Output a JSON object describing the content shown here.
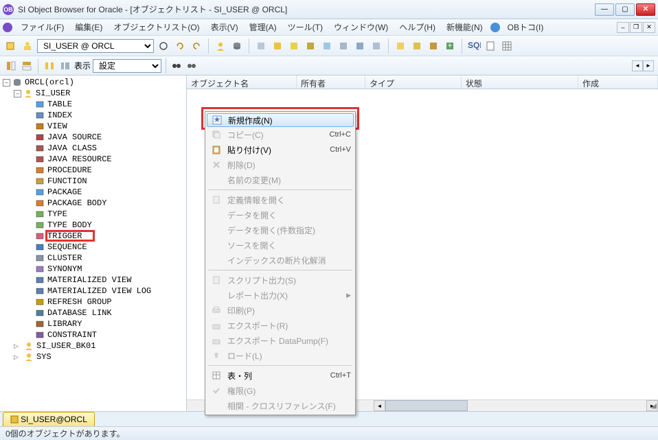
{
  "title": "SI Object Browser for Oracle - [オブジェクトリスト - SI_USER @ ORCL]",
  "menus": {
    "file": "ファイル(F)",
    "edit": "編集(E)",
    "objlist": "オブジェクトリスト(O)",
    "view": "表示(V)",
    "manage": "管理(A)",
    "tool": "ツール(T)",
    "window": "ウィンドウ(W)",
    "help": "ヘルプ(H)",
    "new_feature": "新機能(N)",
    "obtoko": "OBトコ(I)"
  },
  "toolbar": {
    "user_combo": "SI_USER @ ORCL"
  },
  "subbar": {
    "display_label": "表示",
    "display_combo": "設定"
  },
  "tree": {
    "root": "ORCL(orcl)",
    "schemas": [
      {
        "name": "SI_USER",
        "expanded": true
      },
      {
        "name": "SI_USER_BK01",
        "expanded": false
      },
      {
        "name": "SYS",
        "expanded": false
      }
    ],
    "obj_types": [
      "TABLE",
      "INDEX",
      "VIEW",
      "JAVA SOURCE",
      "JAVA CLASS",
      "JAVA RESOURCE",
      "PROCEDURE",
      "FUNCTION",
      "PACKAGE",
      "PACKAGE BODY",
      "TYPE",
      "TYPE BODY",
      "TRIGGER",
      "SEQUENCE",
      "CLUSTER",
      "SYNONYM",
      "MATERIALIZED VIEW",
      "MATERIALIZED VIEW LOG",
      "REFRESH GROUP",
      "DATABASE LINK",
      "LIBRARY",
      "CONSTRAINT"
    ],
    "icon_colors": {
      "TABLE": "#5aa0e0",
      "INDEX": "#6a8fbf",
      "VIEW": "#c08020",
      "JAVA SOURCE": "#b04848",
      "JAVA CLASS": "#a85858",
      "JAVA RESOURCE": "#a85858",
      "PROCEDURE": "#d88030",
      "FUNCTION": "#c8a040",
      "PACKAGE": "#5aa0e0",
      "PACKAGE BODY": "#d88030",
      "TYPE": "#7ab060",
      "TYPE BODY": "#7ab060",
      "TRIGGER": "#d86080",
      "SEQUENCE": "#4a80c0",
      "CLUSTER": "#8896a8",
      "SYNONYM": "#9a80c0",
      "MATERIALIZED VIEW": "#6080b0",
      "MATERIALIZED VIEW LOG": "#6080b0",
      "REFRESH GROUP": "#c8a000",
      "DATABASE LINK": "#5080a0",
      "LIBRARY": "#a06836",
      "CONSTRAINT": "#8060a0"
    }
  },
  "list_columns": {
    "objname": "オブジェクト名",
    "owner": "所有者",
    "type": "タイプ",
    "status": "状態",
    "created": "作成"
  },
  "context_menu": {
    "new": "新規作成(N)",
    "copy": "コピー(C)",
    "paste": "貼り付け(V)",
    "delete": "削除(D)",
    "rename": "名前の変更(M)",
    "open_def": "定義情報を開く",
    "open_data": "データを開く",
    "open_data_cnt": "データを開く(件数指定)",
    "open_src": "ソースを開く",
    "defrag": "インデックスの断片化解消",
    "script_out": "スクリプト出力(S)",
    "report_out": "レポート出力(X)",
    "print": "印刷(P)",
    "export": "エクスポート(R)",
    "export_dp": "エクスポート DataPump(F)",
    "load": "ロード(L)",
    "table_col": "表・列",
    "privilege": "権限(G)",
    "xref": "相関 - クロスリファレンス(F)",
    "sc_copy": "Ctrl+C",
    "sc_paste": "Ctrl+V",
    "sc_tablecol": "Ctrl+T"
  },
  "tab": "SI_USER@ORCL",
  "status": "0個のオブジェクトがあります。",
  "chart_data": null
}
